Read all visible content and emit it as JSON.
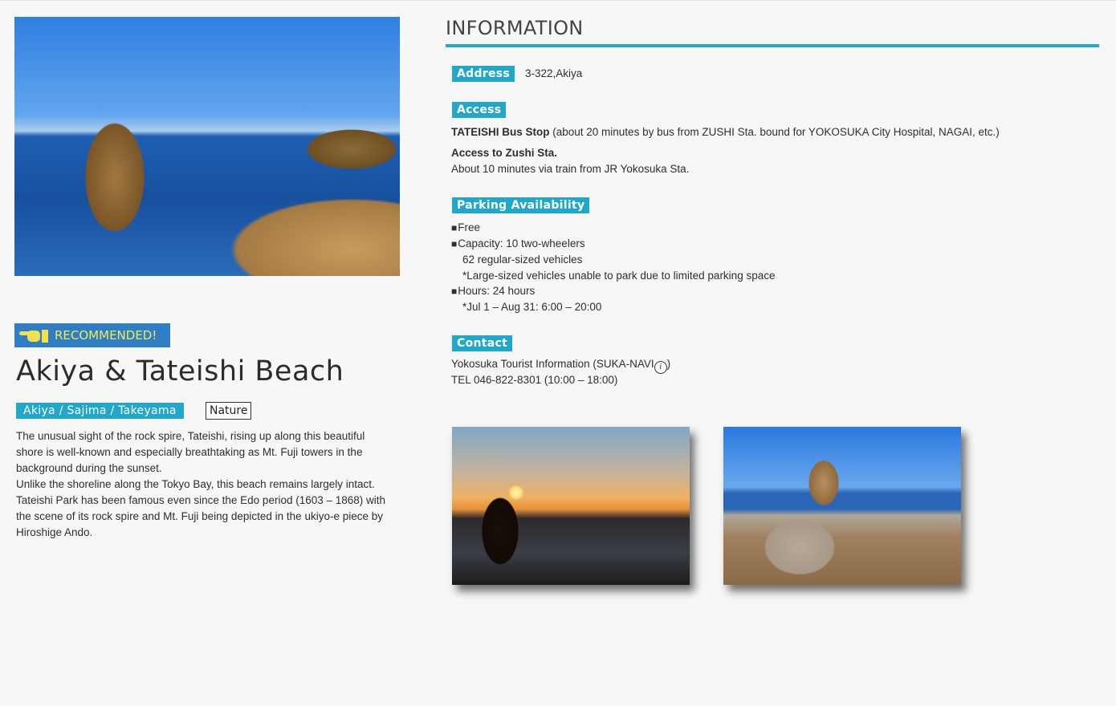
{
  "hero": {
    "badge_label": "RECOMMENDED!",
    "badge_icon": "pointing-hand-icon",
    "title": "Akiya & Tateishi Beach",
    "area_tag": "Akiya / Sajima / Takeyama",
    "category_tag": "Nature",
    "description": "The unusual sight of the rock spire, Tateishi, rising up along this beautiful\nshore is well-known and especially breathtaking as Mt. Fuji towers in the\nbackground during the sunset.\nUnlike the shoreline along the Tokyo Bay, this beach remains largely intact.\nTateishi Park has been famous even since the Edo period (1603 – 1868) with\nthe scene of its rock spire and Mt. Fuji being depicted in the ukiyo-e piece by\nHiroshige Ando."
  },
  "information": {
    "heading": "INFORMATION",
    "address": {
      "label": "Address",
      "value": "3-322,Akiya"
    },
    "access": {
      "label": "Access",
      "bus_stop": "TATEISHI Bus Stop",
      "bus_detail": " (about 20 minutes by bus from ZUSHI Sta. bound for YOKOSUKA City Hospital, NAGAI, etc.)",
      "zushi_heading": "Access to Zushi Sta.",
      "zushi_detail": "About 10 minutes via train from JR Yokosuka Sta."
    },
    "parking": {
      "label": "Parking Availability",
      "lines": [
        "Free",
        "Capacity: 10 two-wheelers",
        "62 regular-sized vehicles",
        "*Large-sized vehicles unable to park due to limited parking space",
        "Hours: 24 hours",
        "*Jul 1 – Aug 31: 6:00 – 20:00"
      ]
    },
    "contact": {
      "label": "Contact",
      "name_prefix": "Yokosuka Tourist Information (SUKA-NAVI",
      "info_glyph": "i",
      "name_suffix": ")",
      "tel": "TEL 046-822-8301 (10:00 – 18:00)"
    }
  },
  "colors": {
    "accent": "#21a7c9",
    "badge_bg": "#2f7dc4",
    "badge_text": "#f4ea4e",
    "page_bg": "#f7f7f7"
  }
}
